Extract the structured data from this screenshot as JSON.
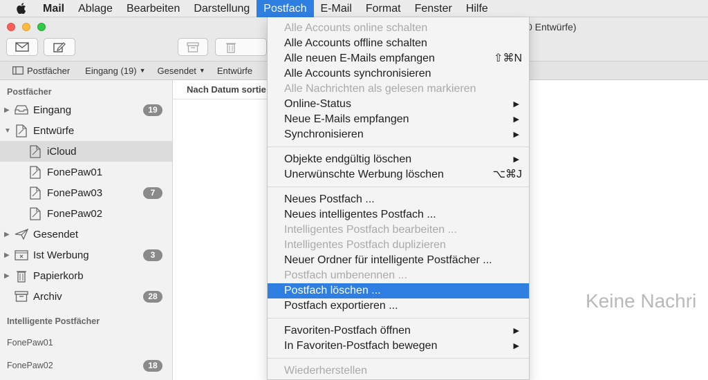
{
  "menubar": {
    "app": "Mail",
    "items": [
      "Ablage",
      "Bearbeiten",
      "Darstellung",
      "Postfach",
      "E-Mail",
      "Format",
      "Fenster",
      "Hilfe"
    ]
  },
  "window": {
    "title_fragment": "0 Entwürfe)"
  },
  "favorites_bar": {
    "postfaecher": "Postfächer",
    "eingang": "Eingang (19)",
    "gesendet": "Gesendet",
    "entwuerfe": "Entwürfe"
  },
  "sidebar": {
    "section_mailboxes": "Postfächer",
    "mailboxes": [
      {
        "label": "Eingang",
        "badge": "19"
      },
      {
        "label": "Entwürfe",
        "badge": ""
      },
      {
        "label": "iCloud",
        "badge": ""
      },
      {
        "label": "FonePaw01",
        "badge": ""
      },
      {
        "label": "FonePaw03",
        "badge": "7"
      },
      {
        "label": "FonePaw02",
        "badge": ""
      },
      {
        "label": "Gesendet",
        "badge": ""
      },
      {
        "label": "Ist Werbung",
        "badge": "3"
      },
      {
        "label": "Papierkorb",
        "badge": ""
      },
      {
        "label": "Archiv",
        "badge": "28"
      }
    ],
    "section_smart": "Intelligente Postfächer",
    "smart": [
      {
        "label": "FonePaw01",
        "badge": ""
      },
      {
        "label": "FonePaw02",
        "badge": "18"
      }
    ]
  },
  "message_list": {
    "sort_label": "Nach Datum sortie",
    "empty_text": "Keine Nachri"
  },
  "postfach_menu": {
    "groups": [
      [
        {
          "label": "Alle Accounts online schalten",
          "disabled": true
        },
        {
          "label": "Alle Accounts offline schalten"
        },
        {
          "label": "Alle neuen E-Mails empfangen",
          "shortcut": "⇧⌘N"
        },
        {
          "label": "Alle Accounts synchronisieren"
        },
        {
          "label": "Alle Nachrichten als gelesen markieren",
          "disabled": true
        },
        {
          "label": "Online-Status",
          "submenu": true
        },
        {
          "label": "Neue E-Mails empfangen",
          "submenu": true
        },
        {
          "label": "Synchronisieren",
          "submenu": true
        }
      ],
      [
        {
          "label": "Objekte endgültig löschen",
          "submenu": true
        },
        {
          "label": "Unerwünschte Werbung löschen",
          "shortcut": "⌥⌘J"
        }
      ],
      [
        {
          "label": "Neues Postfach ..."
        },
        {
          "label": "Neues intelligentes Postfach ..."
        },
        {
          "label": "Intelligentes Postfach bearbeiten ...",
          "disabled": true
        },
        {
          "label": "Intelligentes Postfach duplizieren",
          "disabled": true
        },
        {
          "label": "Neuer Ordner für intelligente Postfächer ..."
        },
        {
          "label": "Postfach umbenennen ...",
          "disabled": true
        },
        {
          "label": "Postfach löschen ...",
          "highlighted": true
        },
        {
          "label": "Postfach exportieren ..."
        }
      ],
      [
        {
          "label": "Favoriten-Postfach öffnen",
          "submenu": true
        },
        {
          "label": "In Favoriten-Postfach bewegen",
          "submenu": true
        }
      ],
      [
        {
          "label": "Wiederherstellen",
          "disabled": true
        }
      ]
    ],
    "arrow_glyph": "▶"
  },
  "colors": {
    "accent": "#2f7fe2",
    "badge": "#8a8a8a",
    "disabled_text": "#a9a9a9"
  }
}
